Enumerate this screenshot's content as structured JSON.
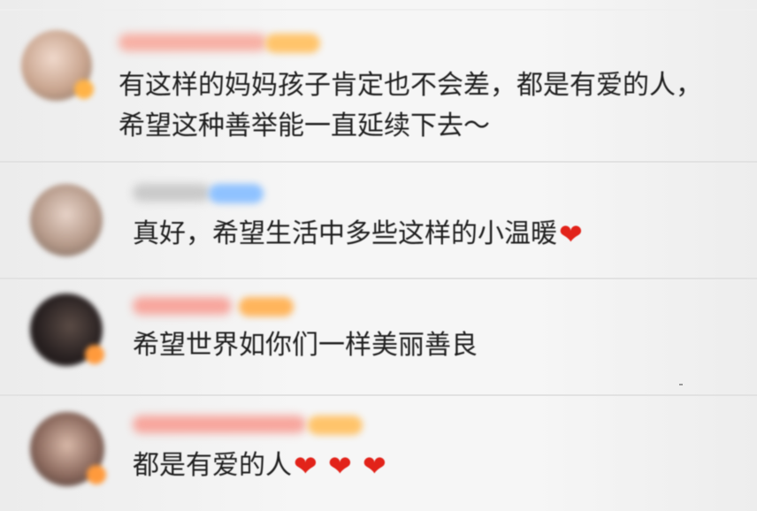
{
  "comments": [
    {
      "text_lines": [
        "有这样的妈妈孩子肯定也不会差，都是有爱的人，",
        "希望这种善举能一直延续下去～"
      ],
      "hearts": ""
    },
    {
      "text_lines": [
        "真好，希望生活中多些这样的小温暖"
      ],
      "hearts": "❤"
    },
    {
      "text_lines": [
        "希望世界如你们一样美丽善良"
      ],
      "hearts": ""
    },
    {
      "text_lines": [
        "都是有爱的人"
      ],
      "hearts": "❤ ❤ ❤"
    }
  ],
  "colors": {
    "username_red": "#f7a59c",
    "vip_orange": "#ffc46b",
    "vip_blue": "#8fc2ff",
    "username_gray": "#c9c9c9",
    "heart_red": "#e2231a",
    "badge_orange": "#ff9a3c"
  }
}
